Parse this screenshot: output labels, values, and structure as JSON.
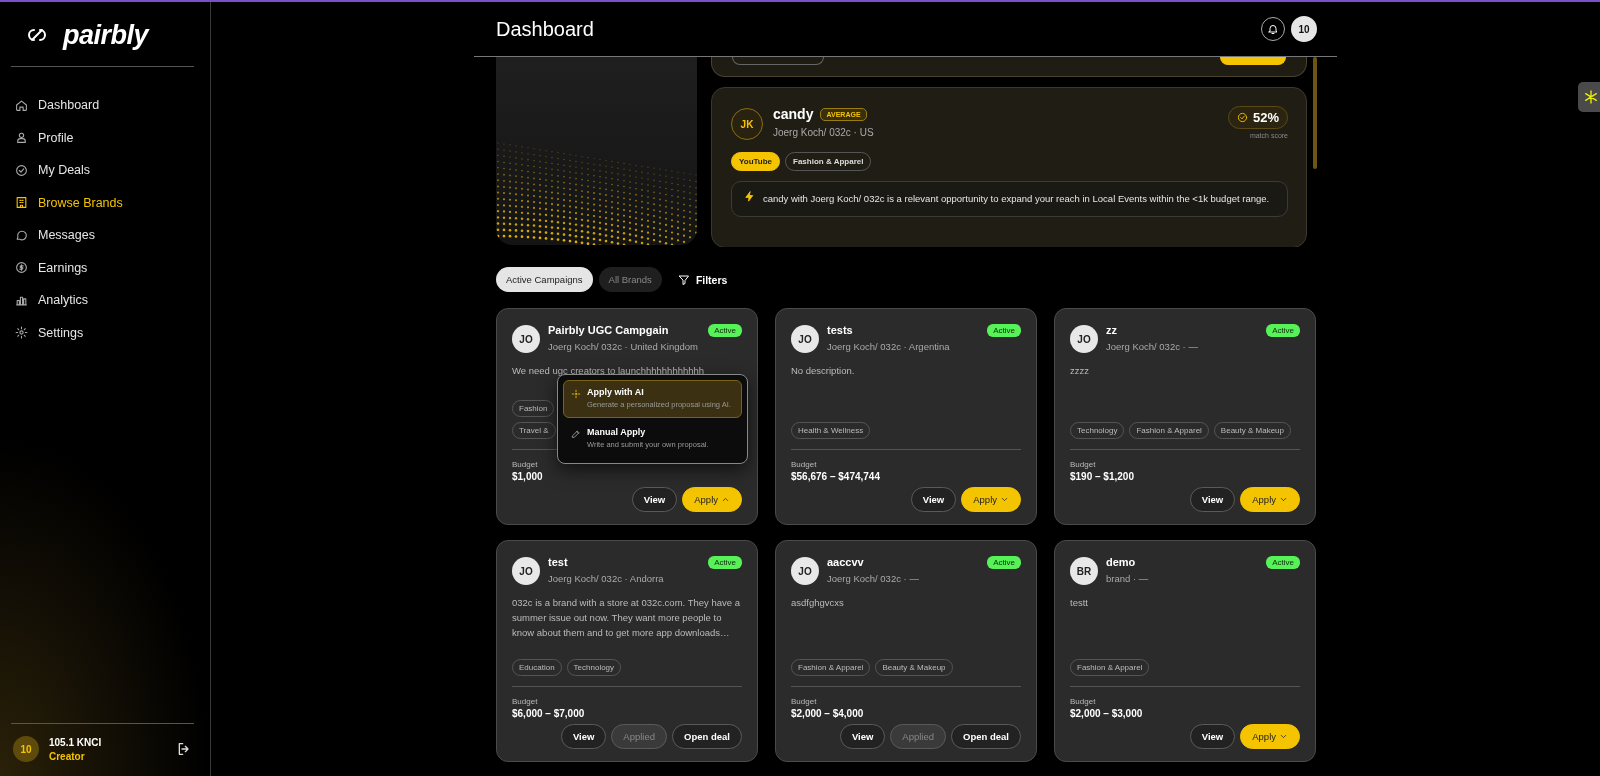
{
  "sidebar": {
    "logo": "pairbly",
    "items": [
      {
        "label": "Dashboard",
        "selected": false
      },
      {
        "label": "Profile",
        "selected": false
      },
      {
        "label": "My Deals",
        "selected": false
      },
      {
        "label": "Browse Brands",
        "selected": true
      },
      {
        "label": "Messages",
        "selected": false
      },
      {
        "label": "Earnings",
        "selected": false
      },
      {
        "label": "Analytics",
        "selected": false
      },
      {
        "label": "Settings",
        "selected": false
      }
    ],
    "user": {
      "initials": "10",
      "name": "105.1 KNCI",
      "role": "Creator"
    }
  },
  "header": {
    "title": "Dashboard",
    "avatar": "10"
  },
  "featured": {
    "initials": "JK",
    "name": "candy",
    "tier": "AVERAGE",
    "meta": "Joerg Koch/ 032c · US",
    "score": "52%",
    "score_label": "match score",
    "tags": [
      {
        "label": "YouTube",
        "kind": "platform"
      },
      {
        "label": "Fashion & Apparel",
        "kind": "category"
      }
    ],
    "insight": "candy with Joerg Koch/ 032c is a relevant opportunity to expand your reach in Local Events within the <1k budget range."
  },
  "filters": {
    "tabs": [
      {
        "label": "Active Campaigns",
        "selected": true
      },
      {
        "label": "All Brands",
        "selected": false
      }
    ],
    "button": "Filters"
  },
  "campaigns": [
    {
      "initials": "JO",
      "title": "Pairbly UGC Campgain",
      "status": "Active",
      "meta": "Joerg Koch/ 032c · United Kingdom",
      "description": "We need ugc creators to launchhhhhhhhhhhh",
      "tags": [
        "Fashion",
        "Travel &"
      ],
      "budget_label": "Budget",
      "budget": "$1,000",
      "actions": [
        {
          "label": "View",
          "kind": "view"
        },
        {
          "label": "Apply",
          "kind": "apply",
          "expanded": true
        }
      ],
      "menu": [
        {
          "title": "Apply with AI",
          "subtitle": "Generate a personalized proposal using AI.",
          "selected": true
        },
        {
          "title": "Manual Apply",
          "subtitle": "Write and submit your own proposal.",
          "selected": false
        }
      ]
    },
    {
      "initials": "JO",
      "title": "tests",
      "status": "Active",
      "meta": "Joerg Koch/ 032c · Argentina",
      "description": "No description.",
      "tags": [
        "Health & Wellness"
      ],
      "budget_label": "Budget",
      "budget": "$56,676 – $474,744",
      "actions": [
        {
          "label": "View",
          "kind": "view"
        },
        {
          "label": "Apply",
          "kind": "apply",
          "expanded": false
        }
      ]
    },
    {
      "initials": "JO",
      "title": "zz",
      "status": "Active",
      "meta": "Joerg Koch/ 032c · —",
      "description": "zzzz",
      "tags": [
        "Technology",
        "Fashion & Apparel",
        "Beauty & Makeup"
      ],
      "budget_label": "Budget",
      "budget": "$190 – $1,200",
      "actions": [
        {
          "label": "View",
          "kind": "view"
        },
        {
          "label": "Apply",
          "kind": "apply",
          "expanded": false
        }
      ]
    },
    {
      "initials": "JO",
      "title": "test",
      "status": "Active",
      "meta": "Joerg Koch/ 032c · Andorra",
      "description": "032c is a brand with a store at 032c.com. They have a summer issue out now. They want more people to know about them and to get more app downloads…",
      "tags": [
        "Education",
        "Technology"
      ],
      "budget_label": "Budget",
      "budget": "$6,000 – $7,000",
      "actions": [
        {
          "label": "View",
          "kind": "view"
        },
        {
          "label": "Applied",
          "kind": "applied"
        },
        {
          "label": "Open deal",
          "kind": "open"
        }
      ]
    },
    {
      "initials": "JO",
      "title": "aaccvv",
      "status": "Active",
      "meta": "Joerg Koch/ 032c · —",
      "description": "asdfghgvcxs",
      "tags": [
        "Fashion & Apparel",
        "Beauty & Makeup"
      ],
      "budget_label": "Budget",
      "budget": "$2,000 – $4,000",
      "actions": [
        {
          "label": "View",
          "kind": "view"
        },
        {
          "label": "Applied",
          "kind": "applied"
        },
        {
          "label": "Open deal",
          "kind": "open"
        }
      ]
    },
    {
      "initials": "BR",
      "title": "demo",
      "status": "Active",
      "meta": "brand · —",
      "description": "testt",
      "tags": [
        "Fashion & Apparel"
      ],
      "budget_label": "Budget",
      "budget": "$2,000 – $3,000",
      "actions": [
        {
          "label": "View",
          "kind": "view"
        },
        {
          "label": "Apply",
          "kind": "apply",
          "expanded": false
        }
      ]
    }
  ]
}
